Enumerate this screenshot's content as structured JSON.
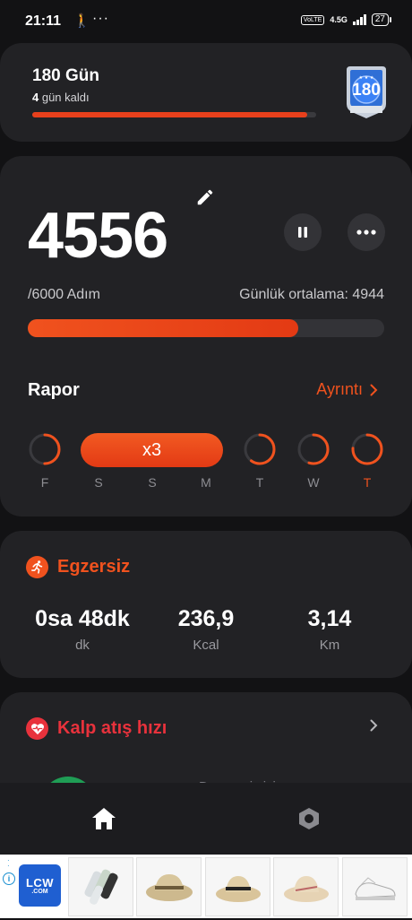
{
  "status_bar": {
    "time": "21:11",
    "network": "4.5G",
    "volte": "VoLTE",
    "battery": "27"
  },
  "challenge": {
    "title": "180 Gün",
    "remaining_count": "4",
    "remaining_suffix": " gün kaldı",
    "progress": 0.97,
    "badge_number": "180"
  },
  "steps": {
    "count": "4556",
    "goal_label": "/6000 Adım",
    "average_label": "Günlük ortalama: 4944",
    "progress_fraction": 0.759
  },
  "report": {
    "title": "Rapor",
    "details_label": "Ayrıntı",
    "streak_label": "x3",
    "days": [
      {
        "label": "F",
        "progress": 0.5,
        "today": false
      },
      {
        "label": "S",
        "progress": 1,
        "today": false
      },
      {
        "label": "S",
        "progress": 1,
        "today": false
      },
      {
        "label": "M",
        "progress": 1,
        "today": false
      },
      {
        "label": "T",
        "progress": 0.6,
        "today": false
      },
      {
        "label": "W",
        "progress": 0.55,
        "today": false
      },
      {
        "label": "T",
        "progress": 0.76,
        "today": true
      }
    ]
  },
  "exercise": {
    "title": "Egzersiz",
    "stats": [
      {
        "value": "0sa 48dk",
        "unit": "dk"
      },
      {
        "value": "236,9",
        "unit": "Kcal"
      },
      {
        "value": "3,14",
        "unit": "Km"
      }
    ]
  },
  "heart_rate": {
    "title": "Kalp atış hızı",
    "partial_text": "Dereceniz iyi"
  },
  "nav": {
    "items": [
      "home-icon",
      "settings-icon"
    ]
  },
  "ad": {
    "logo_line1": "LCW",
    "logo_line2": ".COM"
  },
  "colors": {
    "accent": "#f0521e",
    "heart": "#e8323c",
    "card": "#222225",
    "background": "#121214"
  }
}
